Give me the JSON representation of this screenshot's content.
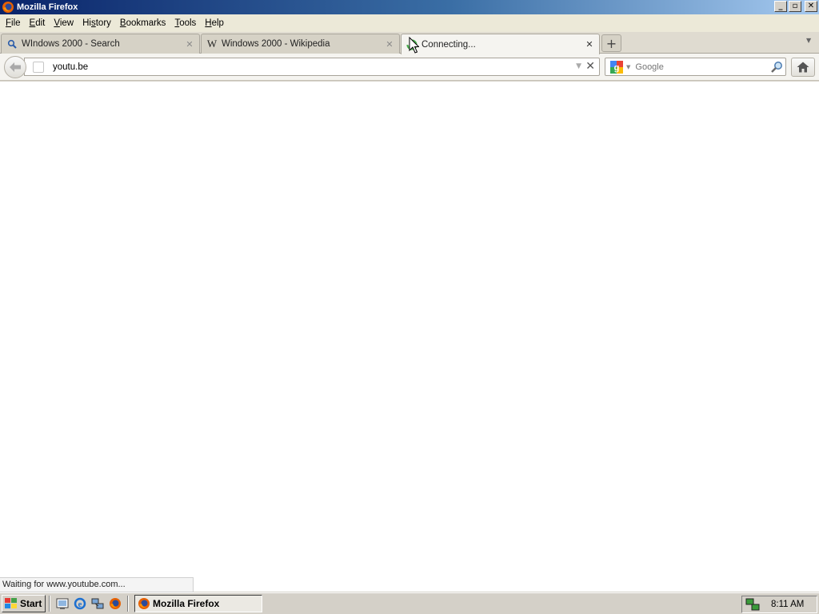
{
  "window": {
    "title": "Mozilla Firefox",
    "controls": {
      "minimize": "_",
      "maximize": "▫",
      "close": "✕"
    }
  },
  "menubar": {
    "items": [
      {
        "underline": "F",
        "rest": "ile"
      },
      {
        "underline": "E",
        "rest": "dit"
      },
      {
        "underline": "V",
        "rest": "iew"
      },
      {
        "pre": "Hi",
        "underline": "s",
        "rest": "tory"
      },
      {
        "underline": "B",
        "rest": "ookmarks"
      },
      {
        "underline": "T",
        "rest": "ools"
      },
      {
        "underline": "H",
        "rest": "elp"
      }
    ]
  },
  "tabs": [
    {
      "label": "WIndows 2000 - Search",
      "icon": "search-icon",
      "active": false
    },
    {
      "label": "Windows 2000 - Wikipedia",
      "icon": "wikipedia-icon",
      "active": false
    },
    {
      "label": "Connecting...",
      "icon": "loading-spinner-icon",
      "active": true
    }
  ],
  "tab_controls": {
    "close": "✕",
    "new_tab": "+",
    "list_all": "▼"
  },
  "navbar": {
    "url": "youtu.be",
    "search_placeholder": "Google",
    "stop": "✕",
    "dropmarker": "▼"
  },
  "status": {
    "text": "Waiting for www.youtube.com..."
  },
  "taskbar": {
    "start_label": "Start",
    "quicklaunch": [
      "desktop-icon",
      "internet-explorer-icon",
      "network-icon",
      "firefox-icon"
    ],
    "task_label": "Mozilla Firefox",
    "clock": "8:11 AM"
  },
  "colors": {
    "titlebar_start": "#0a246a",
    "titlebar_end": "#a6caf0",
    "chrome_bg": "#d4d0c8",
    "spinner": "#4caf50"
  }
}
